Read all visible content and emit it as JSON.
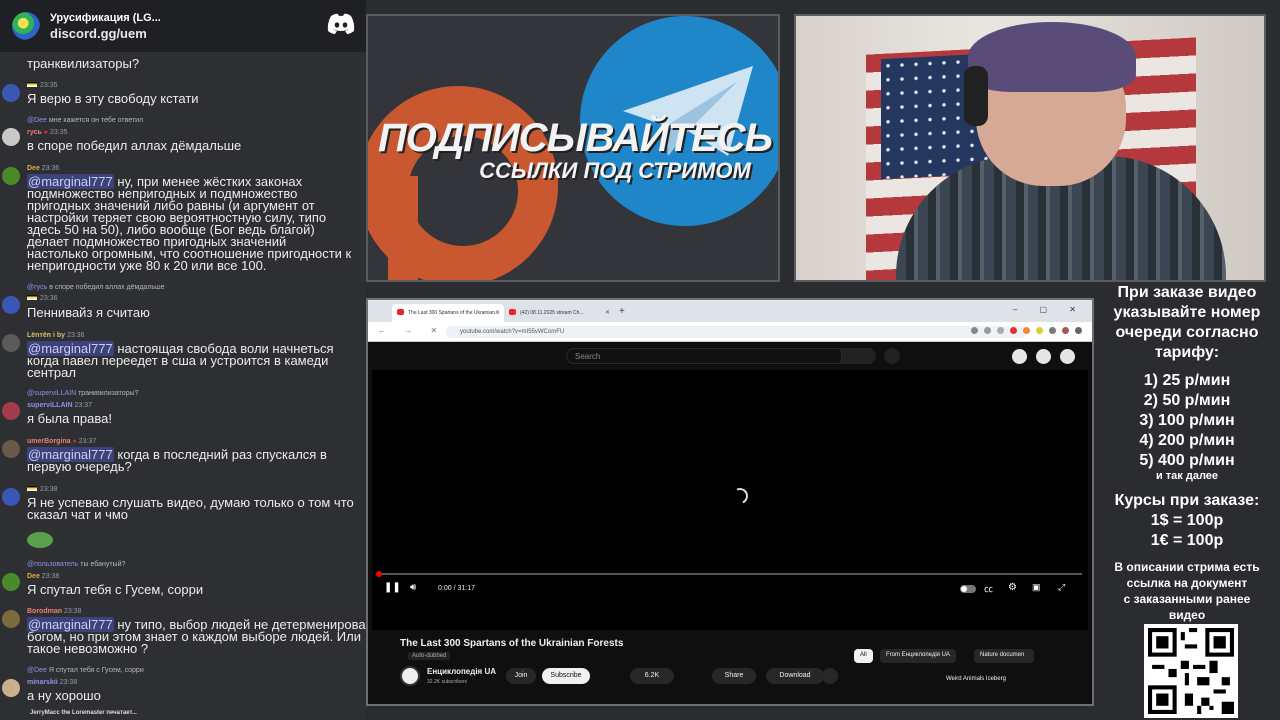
{
  "discord": {
    "server_name": "Урусификация (LG...",
    "server_link": "discord.gg/uem"
  },
  "chat": [
    {
      "id": "m0",
      "meta_nick": "",
      "meta_time": "",
      "body": "транквилизаторы?"
    },
    {
      "id": "m1",
      "meta_nick": "",
      "meta_time": "23:35",
      "body": "Я верю в эту свободу кстати"
    },
    {
      "id": "m2",
      "reply_nick": "@Dee",
      "reply_text": "мне кажется он тебе ответил",
      "meta_nick": "гусь",
      "meta_time": "23:35",
      "body": "в споре победил аллах дёмдальше"
    },
    {
      "id": "m3",
      "meta_nick": "Dee",
      "meta_time": "23:36",
      "mention": "@marginal777",
      "body_first": " ну, при менее жёстких законах",
      "body": "подмножество непригодных и подмножество\nпригодных значений либо равны (и аргумент от\nнастройки теряет свою вероятностную силу, типо\nздесь 50 на 50), либо вообще (Бог ведь благой)\nделает подмножество пригодных значений\nнастолько огромным, что соотношение пригодности к\nнепригодности уже 80 к 20 или все 100."
    },
    {
      "id": "m4",
      "reply_nick": "@гусь",
      "reply_text": "в споре победил аллах дёмдальше",
      "meta_nick": "",
      "meta_time": "23:36",
      "body": "Пеннивайз я считаю"
    },
    {
      "id": "m5",
      "meta_nick": "Lёnтёп і bу",
      "meta_time": "23:36",
      "mention": "@marginal777",
      "body_first": " настоящая свобода воли начнеться",
      "body": "когда павел переедет в сша и устроится в камеди\nсентрал"
    },
    {
      "id": "m6",
      "reply_nick": "@superviLLAIN",
      "reply_text": "транквилизаторы?",
      "meta_nick": "superviLLAIN",
      "meta_time": "23:37",
      "body": "я была права!"
    },
    {
      "id": "m7",
      "meta_nick": "umerBorgina",
      "meta_time": "23:37",
      "mention": "@marginal777",
      "body_first": " когда в последний раз спускался в",
      "body": "первую очередь?"
    },
    {
      "id": "m8",
      "meta_nick": "",
      "meta_time": "23:38",
      "body": "Я не успеваю слушать видео, думаю только о том что\nсказал чат и чмо"
    },
    {
      "id": "m9",
      "reply_nick": "@пользователь",
      "reply_text": "ты ебанутый?",
      "meta_nick": "Dee",
      "meta_time": "23:38",
      "body": "Я спутал тебя с Гусем, сорри"
    },
    {
      "id": "m10",
      "meta_nick": "Borodman",
      "meta_time": "23:38",
      "mention": "@marginal777",
      "body_first": " ну типо, выбор людей не детерменирован",
      "body": "богом, но при этом знает о каждом выборе людей. Или\nтакое невозможно ?"
    },
    {
      "id": "m11",
      "reply_nick": "@Dee",
      "reply_text": "Я спутал тебя с Гусем, сорри",
      "meta_nick": "minarskii",
      "meta_time": "23:38",
      "body": "а ну хорошо"
    },
    {
      "id": "m12",
      "typing": "JerryMacc the Loremaster печатает..."
    }
  ],
  "promo": {
    "title": "ПОДПИСЫВАЙТЕСЬ",
    "subtitle": "ССЫЛКИ ПОД СТРИМОМ"
  },
  "browser": {
    "tabs": [
      {
        "label": "The Last 300 Spartans of the Ukrainian...",
        "active": true
      },
      {
        "label": "(42) 08.11.2025 stream Ch...",
        "active": false
      }
    ],
    "url": "youtube.com/watch?v=mI55vWComFU",
    "new_tab": "+",
    "window_controls": "– ▢ ✕"
  },
  "youtube": {
    "search_placeholder": "Search",
    "time": "0:00 / 31:17",
    "progress_fraction": 0.003,
    "title": "The Last 300 Spartans of the Ukrainian Forests",
    "auto_dubbed": "Auto-dubbed",
    "channel": "Енциклопедія UA",
    "subscribers": "32.2K subscribers",
    "join": "Join",
    "subscribe": "Subscribe",
    "likes": "6.2K",
    "share": "Share",
    "download": "Download",
    "chips": [
      "All",
      "From Енциклопедія UA",
      "Nature documen"
    ],
    "recommendation": "Weird Animals Iceberg"
  },
  "info": {
    "lines_head": [
      "При заказе видео",
      "указывайте номер",
      "очереди согласно",
      "тарифу:"
    ],
    "tariffs": [
      "1) 25 р/мин",
      "2) 50 р/мин",
      "3) 100 р/мин",
      "4) 200 р/мин",
      "5) 400 р/мин"
    ],
    "etc": "и так далее",
    "courses_title": "Курсы при заказе:",
    "rates": [
      "1$ = 100р",
      "1€ = 100р"
    ],
    "desc": [
      "В описании стрима есть",
      "ссылка на документ",
      "с заказанными ранее",
      "видео"
    ]
  },
  "colors": {
    "mention_bg": "#3d4278",
    "telegram_blue": "#1f86c9",
    "patreon_orange": "#c9572f",
    "yt_red": "#ff0000"
  }
}
